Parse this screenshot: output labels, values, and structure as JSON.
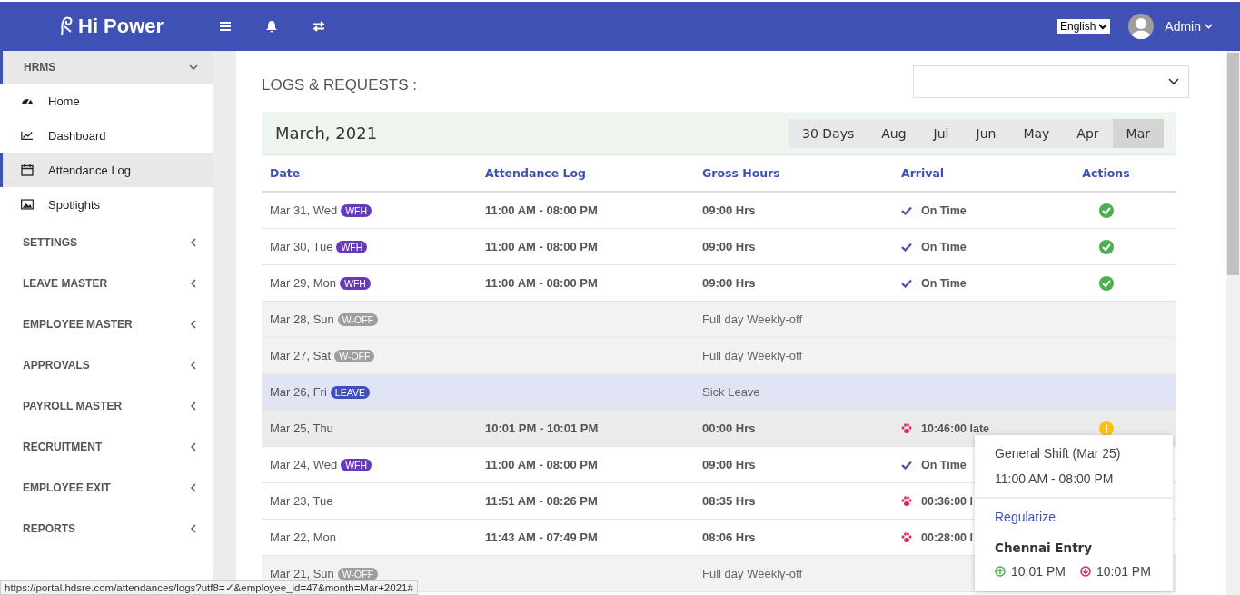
{
  "topbar": {
    "logo": "Hi Power",
    "language": "English",
    "user": "Admin"
  },
  "sidebar": {
    "header": {
      "label": "HRMS",
      "expanded": true
    },
    "items": [
      {
        "label": "Home",
        "selected": false
      },
      {
        "label": "Dashboard",
        "selected": false
      },
      {
        "label": "Attendance Log",
        "selected": true
      },
      {
        "label": "Spotlights",
        "selected": false
      }
    ],
    "sections": [
      "SETTINGS",
      "LEAVE MASTER",
      "EMPLOYEE MASTER",
      "APPROVALS",
      "PAYROLL MASTER",
      "RECRUITMENT",
      "EMPLOYEE EXIT",
      "REPORTS"
    ]
  },
  "page_title": "LOGS & REQUESTS :",
  "month_title": "March, 2021",
  "periods": [
    {
      "label": "30 Days",
      "selected": false
    },
    {
      "label": "Aug",
      "selected": false
    },
    {
      "label": "Jul",
      "selected": false
    },
    {
      "label": "Jun",
      "selected": false
    },
    {
      "label": "May",
      "selected": false
    },
    {
      "label": "Apr",
      "selected": false
    },
    {
      "label": "Mar",
      "selected": true
    }
  ],
  "table": {
    "columns": [
      "Date",
      "Attendance Log",
      "Gross Hours",
      "Arrival",
      "Actions"
    ],
    "rows": [
      {
        "kind": "work",
        "date": "Mar 31, Wed",
        "badge": {
          "text": "WFH",
          "kind": "wfh"
        },
        "log": "11:00 AM - 08:00 PM",
        "hours": "09:00 Hrs",
        "arrival": {
          "kind": "ontime",
          "text": "On Time"
        },
        "action": {
          "kind": "ok"
        }
      },
      {
        "kind": "work",
        "date": "Mar 30, Tue",
        "badge": {
          "text": "WFH",
          "kind": "wfh"
        },
        "log": "11:00 AM - 08:00 PM",
        "hours": "09:00 Hrs",
        "arrival": {
          "kind": "ontime",
          "text": "On Time"
        },
        "action": {
          "kind": "ok"
        }
      },
      {
        "kind": "work",
        "date": "Mar 29, Mon",
        "badge": {
          "text": "WFH",
          "kind": "wfh"
        },
        "log": "11:00 AM - 08:00 PM",
        "hours": "09:00 Hrs",
        "arrival": {
          "kind": "ontime",
          "text": "On Time"
        },
        "action": {
          "kind": "ok"
        }
      },
      {
        "kind": "off",
        "date": "Mar 28, Sun",
        "badge": {
          "text": "W-OFF",
          "kind": "off"
        },
        "note": "Full day Weekly-off"
      },
      {
        "kind": "off",
        "date": "Mar 27, Sat",
        "badge": {
          "text": "W-OFF",
          "kind": "off"
        },
        "note": "Full day Weekly-off"
      },
      {
        "kind": "leave",
        "date": "Mar 26, Fri",
        "badge": {
          "text": "LEAVE",
          "kind": "leave"
        },
        "note": "Sick Leave"
      },
      {
        "kind": "hover",
        "date": "Mar 25, Thu",
        "log": "10:01 PM - 10:01 PM",
        "hours": "00:00 Hrs",
        "arrival": {
          "kind": "late",
          "text": "10:46:00 late"
        },
        "action": {
          "kind": "warn"
        }
      },
      {
        "kind": "work",
        "date": "Mar 24, Wed",
        "badge": {
          "text": "WFH",
          "kind": "wfh"
        },
        "log": "11:00 AM - 08:00 PM",
        "hours": "09:00 Hrs",
        "arrival": {
          "kind": "ontime",
          "text": "On Time"
        }
      },
      {
        "kind": "work",
        "date": "Mar 23, Tue",
        "log": "11:51 AM - 08:26 PM",
        "hours": "08:35 Hrs",
        "arrival": {
          "kind": "late",
          "text": "00:36:00 l"
        }
      },
      {
        "kind": "work",
        "date": "Mar 22, Mon",
        "log": "11:43 AM - 07:49 PM",
        "hours": "08:06 Hrs",
        "arrival": {
          "kind": "late",
          "text": "00:28:00 l"
        }
      },
      {
        "kind": "off",
        "date": "Mar 21, Sun",
        "badge": {
          "text": "W-OFF",
          "kind": "off"
        },
        "note": "Full day Weekly-off"
      }
    ]
  },
  "popover": {
    "shift": "General Shift (Mar 25)",
    "time": "11:00 AM - 08:00 PM",
    "link": "Regularize",
    "entry_title": "Chennai Entry",
    "in_time": "10:01 PM",
    "out_time": "10:01 PM"
  },
  "status_bar": "https://portal.hdsre.com/attendances/logs?utf8=✓&employee_id=47&month=Mar+2021#"
}
